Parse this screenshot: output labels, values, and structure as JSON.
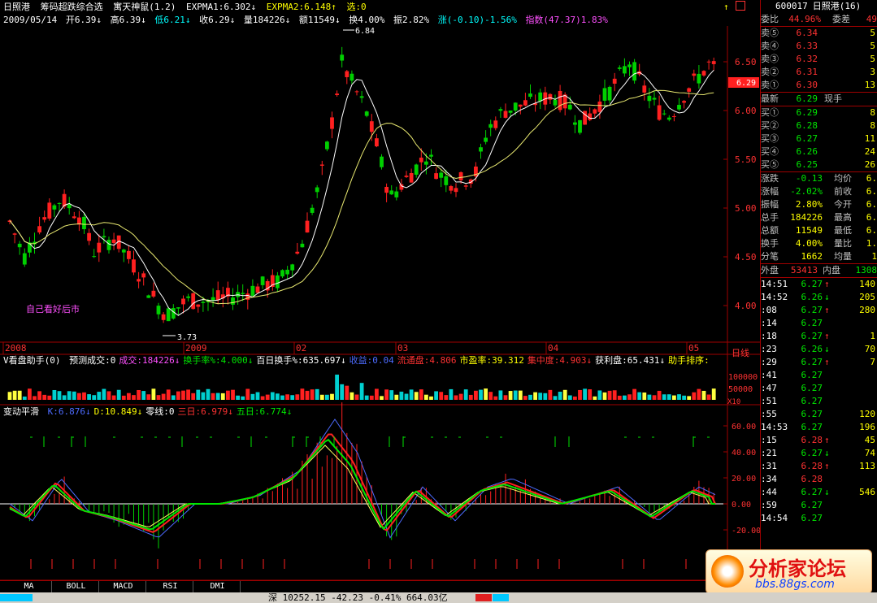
{
  "header": {
    "stock": "日照港",
    "indicator_sel": "筹码超跌综合选",
    "indicator2": "寓天神鼠(1.2)",
    "ema1": "EXPMA1:6.302↓",
    "ema2": "EXPMA2:6.148↑",
    "select": "选:0"
  },
  "info": {
    "date": "2009/05/14",
    "open": "开6.39↓",
    "high": "高6.39↓",
    "low": "低6.21↓",
    "close": "收6.29↓",
    "vol": "量184226↓",
    "amt": "额11549↓",
    "turn": "换4.00%",
    "amp": "振2.82%",
    "chg": "涨(-0.10)-1.56%",
    "idx": "指数(47.37)1.83%"
  },
  "main_chart": {
    "price_labels": [
      "6.50",
      "6.00",
      "5.50",
      "5.00",
      "4.50",
      "4.00"
    ],
    "high_label": "6.84",
    "low_label": "3.73",
    "current": "6.29",
    "annotation": "自己看好后市",
    "dates": [
      "2008",
      "2009",
      "02",
      "03",
      "04",
      "05"
    ],
    "period": "日线"
  },
  "vol_panel": {
    "title": "V看盘助手(0)",
    "items": [
      {
        "t": "预测成交:0",
        "c": "w"
      },
      {
        "t": "成交:184226↓",
        "c": "m"
      },
      {
        "t": "换手率%:4.000↓",
        "c": "g"
      },
      {
        "t": "百日换手%:635.697↓",
        "c": "w"
      },
      {
        "t": "收益:0.04",
        "c": "b"
      },
      {
        "t": "流通盘:4.806",
        "c": "r"
      },
      {
        "t": "市盈率:39.312",
        "c": "y"
      },
      {
        "t": "集中度:4.903↓",
        "c": "r"
      },
      {
        "t": "获利盘:65.431↓",
        "c": "w"
      },
      {
        "t": "助手排序:",
        "c": "y"
      }
    ],
    "axis": [
      "100000",
      "50000",
      "X10"
    ]
  },
  "kdj_panel": {
    "title": "变动平滑",
    "items": [
      {
        "t": "K:6.876↓",
        "c": "b"
      },
      {
        "t": "D:10.849↓",
        "c": "y"
      },
      {
        "t": "零线:0",
        "c": "w"
      },
      {
        "t": "三日:6.979↓",
        "c": "r"
      },
      {
        "t": "五日:6.774↓",
        "c": "g"
      }
    ],
    "axis": [
      "60.00",
      "40.00",
      "20.00",
      "0.00",
      "-20.00"
    ]
  },
  "tabs": [
    "MA",
    "BOLL",
    "MACD",
    "RSI",
    "DMI"
  ],
  "right": {
    "code": "600017",
    "name": "日照港(16)",
    "weibi_label": "委比",
    "weibi": "44.96%",
    "weicha_label": "委差",
    "weicha": "49",
    "sells": [
      {
        "l": "卖⑤",
        "p": "6.34",
        "v": "5"
      },
      {
        "l": "卖④",
        "p": "6.33",
        "v": "5"
      },
      {
        "l": "卖③",
        "p": "6.32",
        "v": "5"
      },
      {
        "l": "卖②",
        "p": "6.31",
        "v": "3"
      },
      {
        "l": "卖①",
        "p": "6.30",
        "v": "13"
      }
    ],
    "latest_label": "最新",
    "latest": "6.29",
    "xianshou": "现手",
    "buys": [
      {
        "l": "买①",
        "p": "6.29",
        "v": "8"
      },
      {
        "l": "买②",
        "p": "6.28",
        "v": "8"
      },
      {
        "l": "买③",
        "p": "6.27",
        "v": "11"
      },
      {
        "l": "买④",
        "p": "6.26",
        "v": "24"
      },
      {
        "l": "买⑤",
        "p": "6.25",
        "v": "26"
      }
    ],
    "stats": [
      [
        "涨跌",
        "-0.13",
        "均价",
        "6."
      ],
      [
        "涨幅",
        "-2.02%",
        "前收",
        "6."
      ],
      [
        "振幅",
        "2.80%",
        "今开",
        "6."
      ],
      [
        "总手",
        "184226",
        "最高",
        "6."
      ],
      [
        "总额",
        "11549",
        "最低",
        "6."
      ],
      [
        "换手",
        "4.00%",
        "量比",
        "1."
      ],
      [
        "分笔",
        "1662",
        "均量",
        "1"
      ]
    ],
    "waipan_label": "外盘",
    "waipan": "53413",
    "neipan_label": "内盘",
    "neipan": "1308",
    "ticks": [
      [
        "14:51",
        "6.27",
        "↑",
        "140"
      ],
      [
        "14:52",
        "6.26",
        "↓",
        "205"
      ],
      [
        ":08",
        "6.27",
        "↑",
        "280"
      ],
      [
        ":14",
        "6.27",
        "",
        ""
      ],
      [
        ":18",
        "6.27",
        "↑",
        "1"
      ],
      [
        ":23",
        "6.26",
        "↓",
        "70"
      ],
      [
        ":29",
        "6.27",
        "↑",
        "7"
      ],
      [
        ":41",
        "6.27",
        "",
        ""
      ],
      [
        ":47",
        "6.27",
        "",
        ""
      ],
      [
        ":51",
        "6.27",
        "",
        ""
      ],
      [
        ":55",
        "6.27",
        "",
        "120"
      ],
      [
        "14:53",
        "6.27",
        "",
        "196"
      ],
      [
        ":15",
        "6.28",
        "↑",
        "45"
      ],
      [
        ":21",
        "6.27",
        "↓",
        "74"
      ],
      [
        ":31",
        "6.28",
        "↑",
        "113"
      ],
      [
        ":34",
        "6.28",
        "",
        ""
      ],
      [
        ":44",
        "6.27",
        "↓",
        "546"
      ],
      [
        ":59",
        "6.27",
        "",
        ""
      ],
      [
        "14:54",
        "6.27",
        "",
        ""
      ]
    ]
  },
  "status": {
    "text": "深 10252.15 -42.23 -0.41% 664.03亿"
  },
  "logo": {
    "text": "分析家论坛",
    "sub": "bbs.88gs.com"
  }
}
